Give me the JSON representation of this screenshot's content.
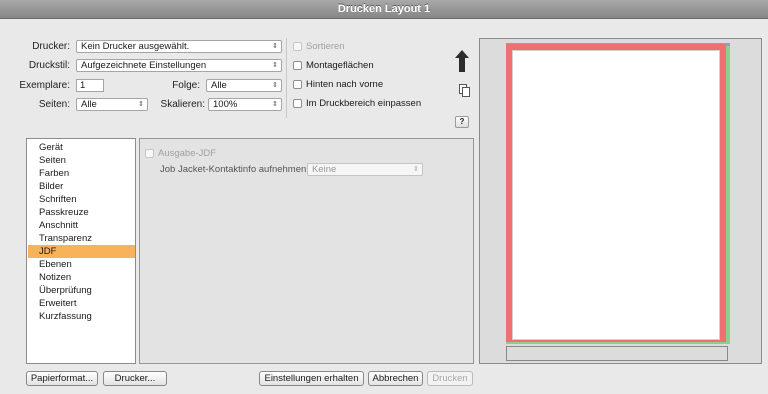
{
  "window": {
    "title": "Drucken Layout 1"
  },
  "form": {
    "drucker_label": "Drucker:",
    "drucker_value": "Kein Drucker ausgewählt.",
    "druckstil_label": "Druckstil:",
    "druckstil_value": "Aufgezeichnete Einstellungen",
    "exemplare_label": "Exemplare:",
    "exemplare_value": "1",
    "folge_label": "Folge:",
    "folge_value": "Alle",
    "seiten_label": "Seiten:",
    "seiten_value": "Alle",
    "skalieren_label": "Skalieren:",
    "skalieren_value": "100%"
  },
  "options": {
    "sortieren": "Sortieren",
    "montageflaechen": "Montageflächen",
    "hinten_nach_vorne": "Hinten nach vorne",
    "im_druckbereich": "Im Druckbereich einpassen"
  },
  "help_button": "?",
  "nav": {
    "items": [
      {
        "label": "Gerät"
      },
      {
        "label": "Seiten"
      },
      {
        "label": "Farben"
      },
      {
        "label": "Bilder"
      },
      {
        "label": "Schriften"
      },
      {
        "label": "Passkreuze"
      },
      {
        "label": "Anschnitt"
      },
      {
        "label": "Transparenz"
      },
      {
        "label": "JDF"
      },
      {
        "label": "Ebenen"
      },
      {
        "label": "Notizen"
      },
      {
        "label": "Überprüfung"
      },
      {
        "label": "Erweitert"
      },
      {
        "label": "Kurzfassung"
      }
    ],
    "selected": "JDF"
  },
  "jdf": {
    "ausgabe_label": "Ausgabe-JDF",
    "job_jacket_label": "Job Jacket-Kontaktinfo aufnehmen:",
    "job_jacket_value": "Keine"
  },
  "buttons": {
    "papierformat": "Papierformat...",
    "drucker": "Drucker...",
    "einstellungen": "Einstellungen erhalten",
    "abbrechen": "Abbrechen",
    "drucken": "Drucken"
  },
  "colors": {
    "selection": "#f8b259",
    "bleed_red": "#ee7070",
    "bleed_green": "#8ccf8c",
    "bleed_purple": "#a393c9"
  },
  "icons": {
    "orientation": "up-arrow-icon",
    "page": "page-copy-icon"
  }
}
